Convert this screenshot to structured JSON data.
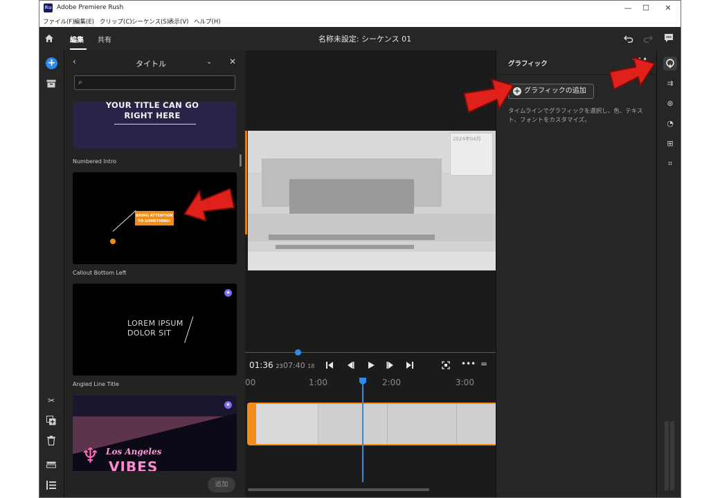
{
  "window": {
    "app_icon": "Ru",
    "title": "Adobe Premiere Rush",
    "controls": [
      "—",
      "☐",
      "✕"
    ]
  },
  "menu": [
    "ファイル(F)",
    "編集(E)",
    "クリップ(C)",
    "シーケンス(S)",
    "表示(V)",
    "ヘルプ(H)"
  ],
  "header": {
    "tabs": [
      "編集",
      "共有"
    ],
    "active_tab": "編集",
    "sequence_title": "名称未設定: シーケンス 01"
  },
  "left_panel": {
    "title": "タイトル",
    "search": {
      "value": "",
      "placeholder": ""
    },
    "templates": [
      {
        "name": "Numbered Intro",
        "preview_text": "YOUR TITLE CAN GO RIGHT HERE",
        "premium": false
      },
      {
        "name": "Callout Bottom Left",
        "preview_text": "BRING ATTENTION TO SOMETHING!",
        "premium": false
      },
      {
        "name": "Angled Line Title",
        "preview_text": "LOREM IPSUM DOLOR SIT",
        "premium": true
      },
      {
        "name": "",
        "preview_text": "Los Angeles",
        "preview_text_2": "VIBES",
        "premium": true
      }
    ],
    "add_button": "追加"
  },
  "monitor": {
    "overlay_card_text": "2024年04月"
  },
  "transport": {
    "current_time": "01:36",
    "current_frames": "23",
    "duration_time": "07:40",
    "duration_frames": "18",
    "scrub_progress": 0.2
  },
  "timeline": {
    "ruler_labels": [
      "00",
      "1:00",
      "2:00",
      "3:00"
    ]
  },
  "right_panel": {
    "title": "グラフィック",
    "more": "•••",
    "add_graphic_button": "グラフィックの追加",
    "description": "タイムラインでグラフィックを選択し、色、テキスト、フォントをカスタマイズ。"
  },
  "colors": {
    "accent_blue": "#2d8ceb",
    "clip_orange": "#f28c1a",
    "annotation_red": "#e0201b",
    "premium_purple": "#7a6cf2"
  },
  "icons": {
    "home": "home-icon",
    "add_media": "plus-circle-icon",
    "project": "archive-icon",
    "undo": "undo-icon",
    "redo": "redo-icon",
    "comment": "speech-bubble-icon"
  }
}
